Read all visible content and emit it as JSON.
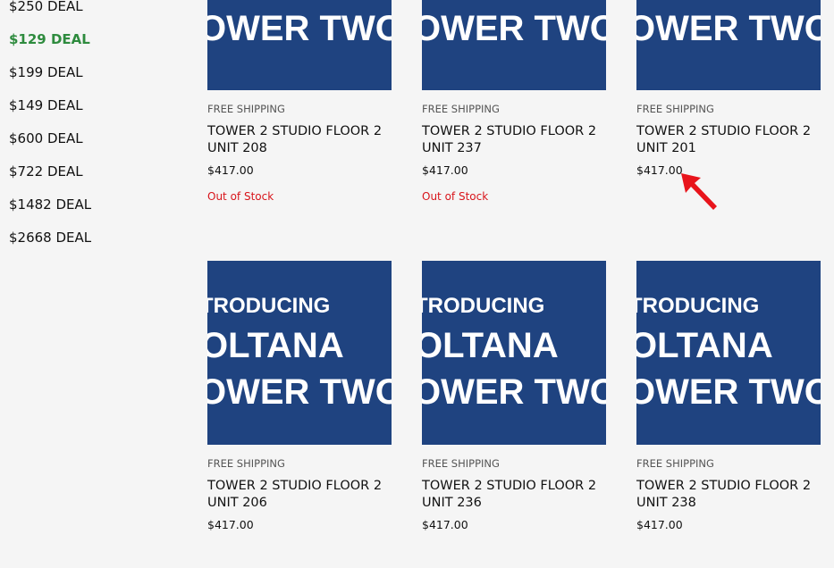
{
  "sidebar": {
    "deals": [
      {
        "label": "$250 DEAL",
        "active": false
      },
      {
        "label": "$129 DEAL",
        "active": true
      },
      {
        "label": "$199 DEAL",
        "active": false
      },
      {
        "label": "$149 DEAL",
        "active": false
      },
      {
        "label": "$600 DEAL",
        "active": false
      },
      {
        "label": "$722 DEAL",
        "active": false
      },
      {
        "label": "$1482 DEAL",
        "active": false
      },
      {
        "label": "$2668 DEAL",
        "active": false
      }
    ]
  },
  "colors": {
    "active_deal": "#2e8b3e",
    "out_of_stock": "#d8151b",
    "thumbnail_bg": "#1f4380",
    "annotation_arrow": "#e8141b"
  },
  "thumbnail_text": {
    "line1": "TRODUCING",
    "line2": "OLTANA",
    "line3": "OWER TWO"
  },
  "products": [
    {
      "shipping": "FREE SHIPPING",
      "name": "TOWER 2 STUDIO FLOOR 2 UNIT 208",
      "price": "$417.00",
      "stock": "Out of Stock"
    },
    {
      "shipping": "FREE SHIPPING",
      "name": "TOWER 2 STUDIO FLOOR 2 UNIT 237",
      "price": "$417.00",
      "stock": "Out of Stock"
    },
    {
      "shipping": "FREE SHIPPING",
      "name": "TOWER 2 STUDIO FLOOR 2 UNIT 201",
      "price": "$417.00",
      "stock": ""
    },
    {
      "shipping": "FREE SHIPPING",
      "name": "TOWER 2 STUDIO FLOOR 2 UNIT 206",
      "price": "$417.00",
      "stock": ""
    },
    {
      "shipping": "FREE SHIPPING",
      "name": "TOWER 2 STUDIO FLOOR 2 UNIT 236",
      "price": "$417.00",
      "stock": ""
    },
    {
      "shipping": "FREE SHIPPING",
      "name": "TOWER 2 STUDIO FLOOR 2 UNIT 238",
      "price": "$417.00",
      "stock": ""
    }
  ],
  "annotation": {
    "icon": "red-arrow-icon"
  }
}
